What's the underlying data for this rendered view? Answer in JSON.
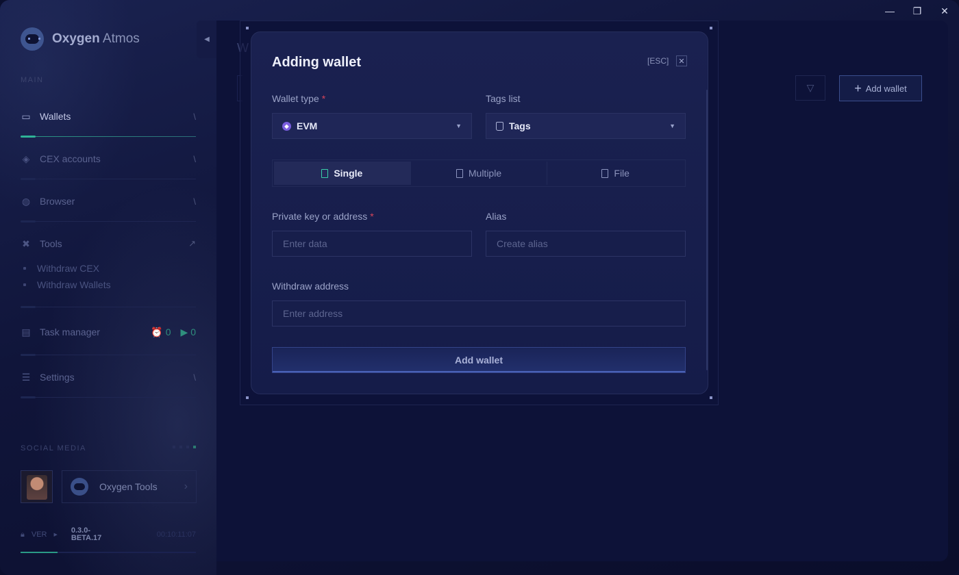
{
  "app": {
    "logo_bold": "Oxygen",
    "logo_rest": " Atmos"
  },
  "sidebar": {
    "main_label": "MAIN",
    "items": [
      {
        "label": "Wallets",
        "icon": "wallet-icon",
        "arrow": "\\"
      },
      {
        "label": "CEX accounts",
        "icon": "layers-icon",
        "arrow": "\\"
      },
      {
        "label": "Browser",
        "icon": "globe-icon",
        "arrow": "\\"
      },
      {
        "label": "Tools",
        "icon": "tools-icon",
        "arrow": "↗"
      },
      {
        "label": "Task manager",
        "icon": "task-icon"
      },
      {
        "label": "Settings",
        "icon": "sliders-icon",
        "arrow": "\\"
      }
    ],
    "tools_sub": [
      "Withdraw CEX",
      "Withdraw Wallets"
    ],
    "task_counters": {
      "scheduled": "0",
      "running": "0"
    },
    "social_label": "SOCIAL MEDIA",
    "social_card": {
      "name": "Oxygen Tools"
    },
    "version": {
      "label": "VER",
      "number": "0.3.0-BETA.17",
      "time": "00:10:11:07"
    }
  },
  "toolbar": {
    "add_wallet": "Add wallet"
  },
  "modal": {
    "title": "Adding wallet",
    "esc": "[ESC]",
    "wallet_type": {
      "label": "Wallet type",
      "required": "*",
      "value": "EVM"
    },
    "tags": {
      "label": "Tags list",
      "value": "Tags"
    },
    "tabs": [
      "Single",
      "Multiple",
      "File"
    ],
    "private_key": {
      "label": "Private key or address",
      "required": "*",
      "placeholder": "Enter data"
    },
    "alias": {
      "label": "Alias",
      "placeholder": "Create alias"
    },
    "withdraw": {
      "label": "Withdraw address",
      "placeholder": "Enter address"
    },
    "submit": "Add wallet"
  },
  "colors": {
    "accent": "#2fb397",
    "background": "#0d1238",
    "modal": "#1a2150",
    "required": "#d6445a"
  }
}
